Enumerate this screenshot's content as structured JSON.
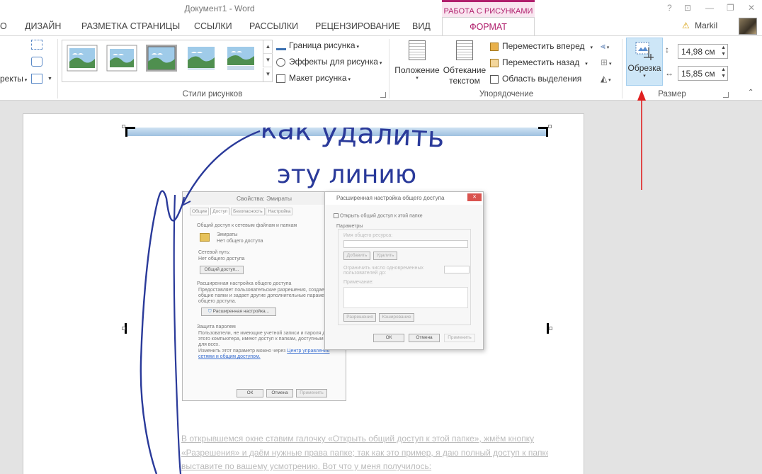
{
  "titlebar": {
    "doc_title": "Документ1 - Word",
    "context_header": "РАБОТА С РИСУНКАМИ",
    "help": "?",
    "ribbon_opts": "⊡",
    "minimize": "—",
    "restore": "❐",
    "close": "✕"
  },
  "tabs": {
    "partial": "О",
    "design": "ДИЗАЙН",
    "layout": "РАЗМЕТКА СТРАНИЦЫ",
    "references": "ССЫЛКИ",
    "mailings": "РАССЫЛКИ",
    "review": "РЕЦЕНЗИРОВАНИЕ",
    "view": "ВИД",
    "format": "ФОРМАТ",
    "user": "Markil"
  },
  "ribbon": {
    "left_partial_effects": "ректы",
    "styles_group_label": "Стили рисунков",
    "border_btn": "Граница рисунка",
    "effects_btn": "Эффекты для рисунка",
    "layout_btn": "Макет рисунка",
    "position_btn": "Положение",
    "wrap_btn_line1": "Обтекание",
    "wrap_btn_line2": "текстом",
    "bring_forward": "Переместить вперед",
    "send_backward": "Переместить назад",
    "selection_pane": "Область выделения",
    "arrange_group_label": "Упорядочение",
    "crop_btn": "Обрезка",
    "height_value": "14,98 см",
    "width_value": "15,85 см",
    "size_group_label": "Размер"
  },
  "picture": {
    "handwriting_line1": "как удалить",
    "handwriting_line2": "эту линию",
    "dialog1_title": "Свойства: Эмираты",
    "dialog1_tabs": [
      "Общие",
      "Доступ",
      "Безопасность",
      "Настройка"
    ],
    "dialog1_section1": "Общий доступ к сетевым файлам и папкам",
    "dialog1_folder": "Эмираты",
    "dialog1_folder_status": "Нет общего доступа",
    "dialog1_netpath_label": "Сетевой путь:",
    "dialog1_netpath_value": "Нет общего доступа",
    "dialog1_share_btn": "Общий доступ...",
    "dialog1_section2": "Расширенная настройка общего доступа",
    "dialog1_section2_text1": "Предоставляет пользовательские разрешения, создает",
    "dialog1_section2_text2": "общие папки и задает другие дополнительные параметр",
    "dialog1_section2_text3": "общего доступа.",
    "dialog1_adv_btn": "Расширенная настройка...",
    "dialog1_section3": "Защита паролем",
    "dialog1_section3_text1": "Пользователи, не имеющие учетной записи и пароля дл",
    "dialog1_section3_text2": "этого компьютера, имеют доступ к папкам, доступным",
    "dialog1_section3_text3": "для всех.",
    "dialog1_section3_text4": "Изменить этот параметр можно через",
    "dialog1_section3_link": "Центр управления",
    "dialog1_section3_link2": "сетями и общим доступом.",
    "dialog1_ok": "ОК",
    "dialog1_cancel": "Отмена",
    "dialog1_apply": "Применить",
    "dialog2_title": "Расширенная настройка общего доступа",
    "dialog2_checkbox": "Открыть общий доступ к этой папке",
    "dialog2_params": "Параметры",
    "dialog2_sharename": "Имя общего ресурса:",
    "dialog2_add": "Добавить",
    "dialog2_remove": "Удалить",
    "dialog2_limit1": "Ограничить число одновременных",
    "dialog2_limit2": "пользователей до:",
    "dialog2_notes": "Примечание:",
    "dialog2_perms": "Разрешения",
    "dialog2_caching": "Кэширование",
    "dialog2_ok": "ОК",
    "dialog2_cancel": "Отмена",
    "dialog2_apply": "Применить",
    "para1": "В открывшемся окне ставим галочку «Открыть общий доступ к этой папке», жмём кнопку",
    "para2": "«Разрешения» и даём нужные права папке; так как это пример, я даю полный доступ к папке",
    "para3": "выставите по вашему усмотрению. Вот что у меня получилось:"
  },
  "colors": {
    "accent": "#b01e6c",
    "selected_button": "#cde6f7",
    "annotation_arrow": "#e02020",
    "handwriting": "#2a3a9a"
  }
}
